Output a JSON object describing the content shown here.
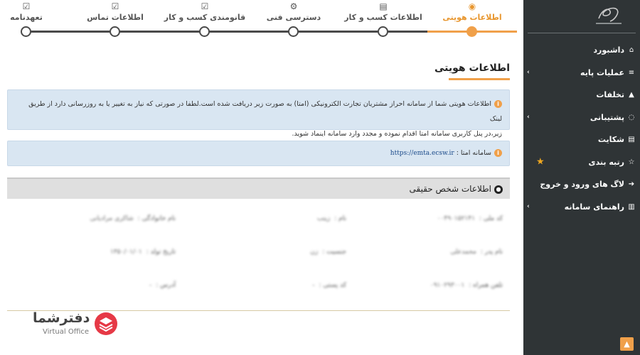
{
  "stepper": {
    "steps": [
      {
        "label": "اطلاعات هویتی",
        "icon": "user-circle-icon"
      },
      {
        "label": "اطلاعات کسب و کار",
        "icon": "document-icon"
      },
      {
        "label": "دسترسی فنی",
        "icon": "gears-icon"
      },
      {
        "label": "قانومندی کسب و کار",
        "icon": "checkbox-icon"
      },
      {
        "label": "اطلاعات تماس",
        "icon": "checkbox-icon"
      },
      {
        "label": "تعهدنامه",
        "icon": "checkbox-icon"
      }
    ],
    "active_index": 0,
    "accent_color": "#f0a04a"
  },
  "main": {
    "title": "اطلاعات هویتی",
    "alert1": {
      "line1": "اطلاعات هویتی شما از سامانه احراز مشتریان تجارت الکترونیکی (امتا) به صورت زیر دریافت شده است.لطفا در صورتی که نیاز به تغییر یا به روزرسانی دارد از طریق لینک",
      "line2": "زیر،در پنل کاربری سامانه امتا اقدام نموده و مجدد وارد سامانه اینماد شوید."
    },
    "alert2": {
      "label": "سامانه امتا :",
      "link": "https://emta.ecsw.ir"
    },
    "panel": {
      "title": "اطلاعات شخص حقیقی",
      "fields": [
        {
          "label": "کد ملی :",
          "value": "۰۰۴۹۰۱۵۲۱۴۱"
        },
        {
          "label": "نام :",
          "value": "زینب"
        },
        {
          "label": "نام خانوادگی :",
          "value": "شاکری مرادیانی"
        },
        {
          "label": "نام پدر :",
          "value": "محمدعلی"
        },
        {
          "label": "جنسیت :",
          "value": "زن"
        },
        {
          "label": "تاریخ تولد :",
          "value": "۱۳۵۰/۰۱/۰۱"
        },
        {
          "label": "تلفن همراه :",
          "value": "۰۹۱۰۲۹۳۰۰۱"
        },
        {
          "label": "کد پستی :",
          "value": "-"
        },
        {
          "label": "آدرس :",
          "value": "-"
        }
      ]
    }
  },
  "sidebar": {
    "items": [
      {
        "label": "داشبورد",
        "icon": "home-icon"
      },
      {
        "label": "عملیات پایه",
        "icon": "list-icon"
      },
      {
        "label": "تخلفات",
        "icon": "warning-icon"
      },
      {
        "label": "پشتیبانی",
        "icon": "comment-icon"
      },
      {
        "label": "شکایت",
        "icon": "document-icon"
      },
      {
        "label": "رتبه بندی",
        "icon": "star-outline-icon"
      },
      {
        "label": "لاگ های ورود و خروج",
        "icon": "sign-in-icon"
      },
      {
        "label": "راهنمای سامانه",
        "icon": "book-icon"
      }
    ]
  },
  "watermark": {
    "brand": "دفترشما",
    "sub": "Virtual Office"
  }
}
